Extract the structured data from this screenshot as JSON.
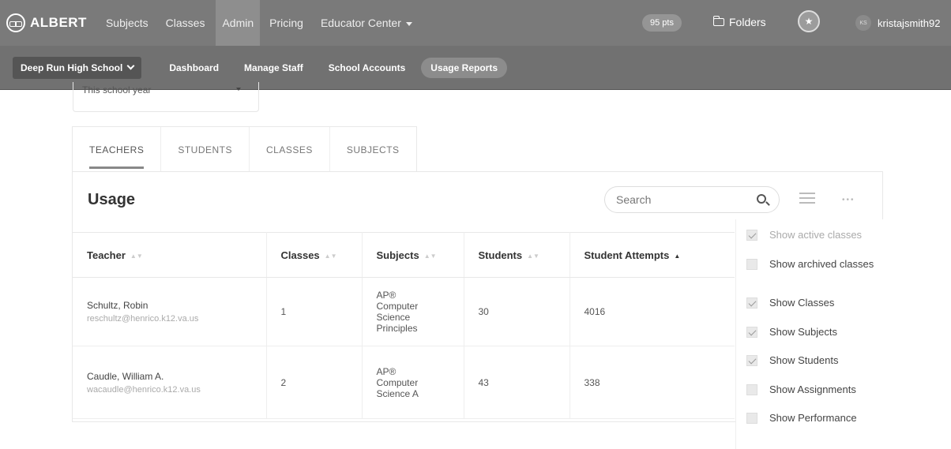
{
  "topnav": {
    "logo": "ALBERT",
    "items": [
      "Subjects",
      "Classes",
      "Admin",
      "Pricing"
    ],
    "educator_center": "Educator Center",
    "points": "95 pts",
    "folders": "Folders",
    "avatar_initials": "KS",
    "username": "kristajsmith92"
  },
  "subnav": {
    "school": "Deep Run High School",
    "items": [
      "Dashboard",
      "Manage Staff",
      "School Accounts",
      "Usage Reports"
    ]
  },
  "period": {
    "label": "This school year"
  },
  "tabs": [
    "TEACHERS",
    "STUDENTS",
    "CLASSES",
    "SUBJECTS"
  ],
  "usage": {
    "title": "Usage",
    "search_placeholder": "Search",
    "columns": [
      "Teacher",
      "Classes",
      "Subjects",
      "Students",
      "Student Attempts"
    ],
    "rows": [
      {
        "name": "Schultz, Robin",
        "email": "reschultz@henrico.k12.va.us",
        "classes": "1",
        "subjects": [
          "AP®",
          "Computer",
          "Science",
          "Principles"
        ],
        "students": "30",
        "attempts": "4016"
      },
      {
        "name": "Caudle, William A.",
        "email": "wacaudle@henrico.k12.va.us",
        "classes": "2",
        "subjects": [
          "AP®",
          "Computer",
          "Science A"
        ],
        "students": "43",
        "attempts": "338"
      }
    ]
  },
  "column_options": [
    {
      "label": "Show active classes",
      "checked": true,
      "disabled": true
    },
    {
      "label": "Show archived classes",
      "checked": false,
      "disabled": false
    },
    {
      "label": "Show Classes",
      "checked": true,
      "disabled": false
    },
    {
      "label": "Show Subjects",
      "checked": true,
      "disabled": false
    },
    {
      "label": "Show Students",
      "checked": true,
      "disabled": false
    },
    {
      "label": "Show Assignments",
      "checked": false,
      "disabled": false
    },
    {
      "label": "Show Performance",
      "checked": false,
      "disabled": false
    }
  ]
}
